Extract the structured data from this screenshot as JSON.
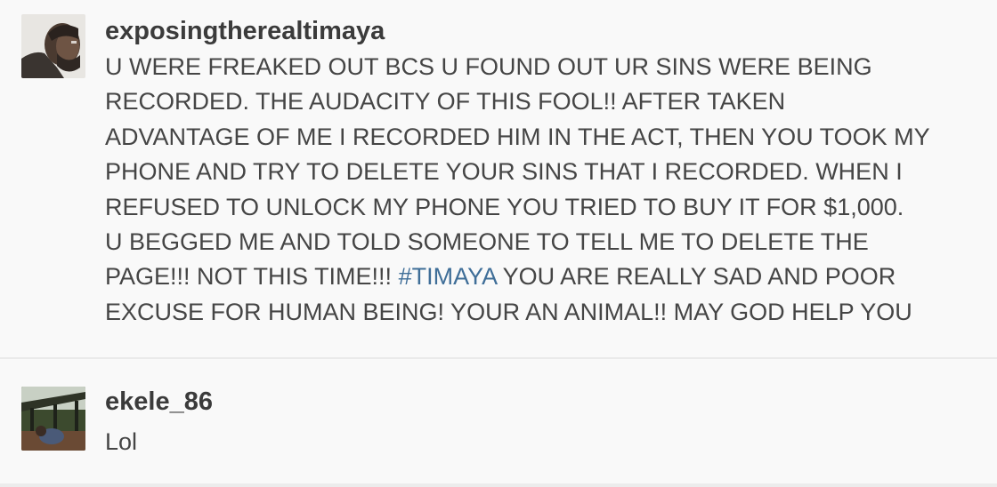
{
  "comments": [
    {
      "username": "exposingtherealtimaya",
      "lines": [
        "U WERE FREAKED OUT BCS U FOUND OUT UR SINS WERE BEING",
        "RECORDED. THE AUDACITY OF THIS FOOL!! AFTER TAKEN",
        "ADVANTAGE OF ME I RECORDED HIM IN THE ACT, THEN YOU TOOK MY",
        "PHONE AND TRY TO DELETE YOUR SINS THAT I RECORDED. WHEN I",
        "REFUSED TO UNLOCK MY PHONE YOU TRIED TO BUY IT FOR $1,000.",
        "U BEGGED ME AND TOLD SOMEONE TO TELL ME TO DELETE THE"
      ],
      "line7_before": "PAGE!!! NOT THIS TIME!!! ",
      "hashtag": "#TIMAYA",
      "line7_after": " YOU ARE REALLY SAD AND POOR",
      "line8": "EXCUSE FOR HUMAN BEING! YOUR AN ANIMAL!! MAY GOD HELP YOU"
    },
    {
      "username": "ekele_86",
      "text": "Lol"
    }
  ],
  "colors": {
    "username": "#3b3b3b",
    "text": "#454545",
    "hashtag": "#3f6e98",
    "background": "#f9f9f9"
  }
}
